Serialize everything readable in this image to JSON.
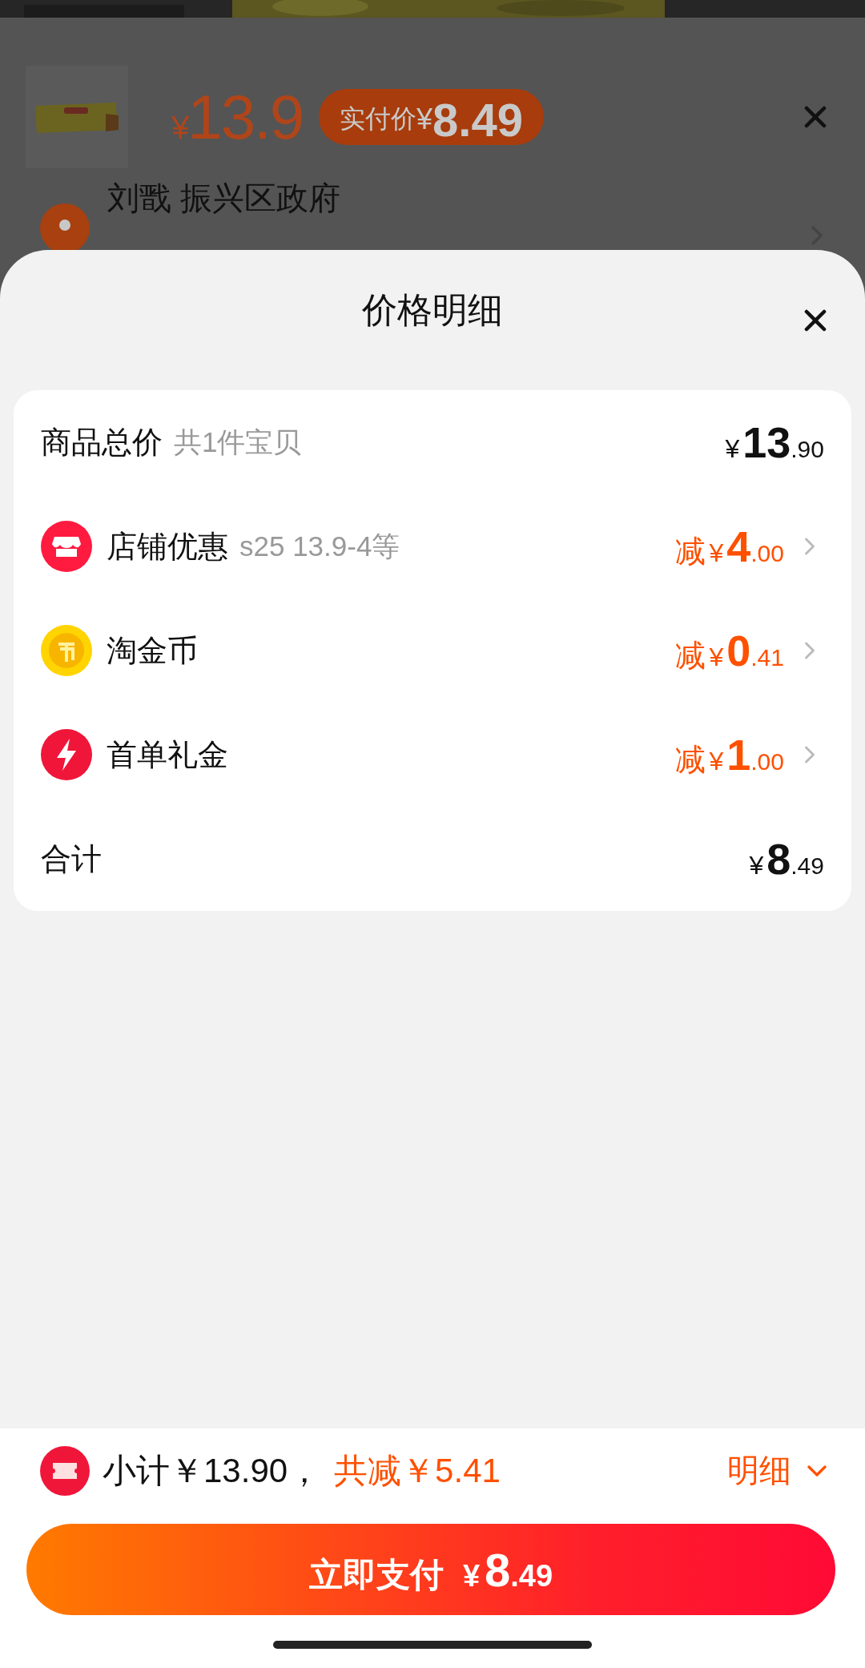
{
  "product": {
    "price": {
      "currency": "¥",
      "amount": "13.9"
    },
    "paid_badge": {
      "label": "实付价",
      "currency": "¥",
      "amount": "8.49"
    }
  },
  "address": {
    "text": "刘戬 振兴区政府"
  },
  "sheet": {
    "title": "价格明细"
  },
  "rows": [
    {
      "kind": "total",
      "label": "商品总价",
      "note": "共1件宝贝",
      "price": {
        "currency": "¥",
        "integer": "13",
        "decimals": ".90"
      }
    },
    {
      "kind": "store",
      "label": "店铺优惠",
      "note": "s25 13.9-4等",
      "price": {
        "prefix": "减",
        "currency": "¥",
        "integer": "4",
        "decimals": ".00"
      }
    },
    {
      "kind": "coin",
      "label": "淘金币",
      "price": {
        "prefix": "减",
        "currency": "¥",
        "integer": "0",
        "decimals": ".41"
      }
    },
    {
      "kind": "bolt",
      "label": "首单礼金",
      "price": {
        "prefix": "减",
        "currency": "¥",
        "integer": "1",
        "decimals": ".00"
      }
    },
    {
      "kind": "total",
      "label": "合计",
      "price": {
        "currency": "¥",
        "integer": "8",
        "decimals": ".49"
      }
    }
  ],
  "footer": {
    "subtotal": "小计￥13.90，",
    "saving": "共减￥5.41",
    "detail_link": "明细"
  },
  "pay_button": {
    "label": "立即支付",
    "currency": "¥",
    "integer": "8",
    "decimals": ".49"
  }
}
